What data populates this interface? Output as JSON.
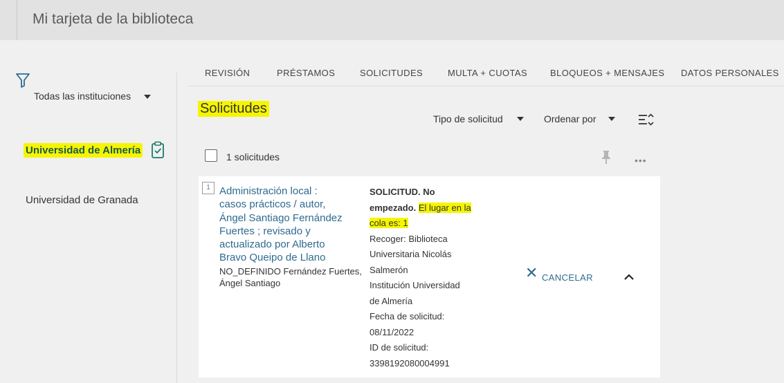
{
  "header": {
    "title": "Mi tarjeta de la biblioteca"
  },
  "sidebar": {
    "filter_icon": "filter-icon",
    "institution_select": "Todas las instituciones",
    "institutions": [
      {
        "label": "Universidad de Almería",
        "active": true,
        "icon": "clipboard-check-icon"
      },
      {
        "label": "Universidad de Granada",
        "active": false
      }
    ]
  },
  "tabs": [
    "REVISIÓN",
    "PRÉSTAMOS",
    "SOLICITUDES",
    "MULTA + CUOTAS",
    "BLOQUEOS + MENSAJES",
    "DATOS PERSONALES"
  ],
  "main": {
    "section_title": "Solicitudes",
    "type_filter": "Tipo de solicitud",
    "sort_label": "Ordenar por",
    "count_label": "1 solicitudes"
  },
  "request": {
    "number": "1",
    "title_lines": [
      "Administración local :",
      "casos prácticos / autor,",
      "Ángel Santiago Fernández",
      "Fuertes ; revisado y",
      "actualizado por Alberto",
      "Bravo Queipo de Llano"
    ],
    "author_lines": [
      "NO_DEFINIDO Fernández Fuertes,",
      "Ángel Santiago"
    ],
    "status_bold_1": "SOLICITUD. No",
    "status_bold_2": "empezado.",
    "queue_part1": "El lugar en la",
    "queue_part2": "cola es: 1",
    "details": [
      "Recoger: Biblioteca",
      "Universitaria Nicolás",
      "Salmerón",
      "Institución Universidad",
      "de Almería",
      "Fecha de solicitud:",
      "08/11/2022",
      "ID de solicitud:",
      "3398192080004991"
    ],
    "cancel_label": "CANCELAR"
  },
  "colors": {
    "highlight": "#f6f500",
    "link": "#2e6b8f",
    "active_institution": "#1a5a4c"
  }
}
